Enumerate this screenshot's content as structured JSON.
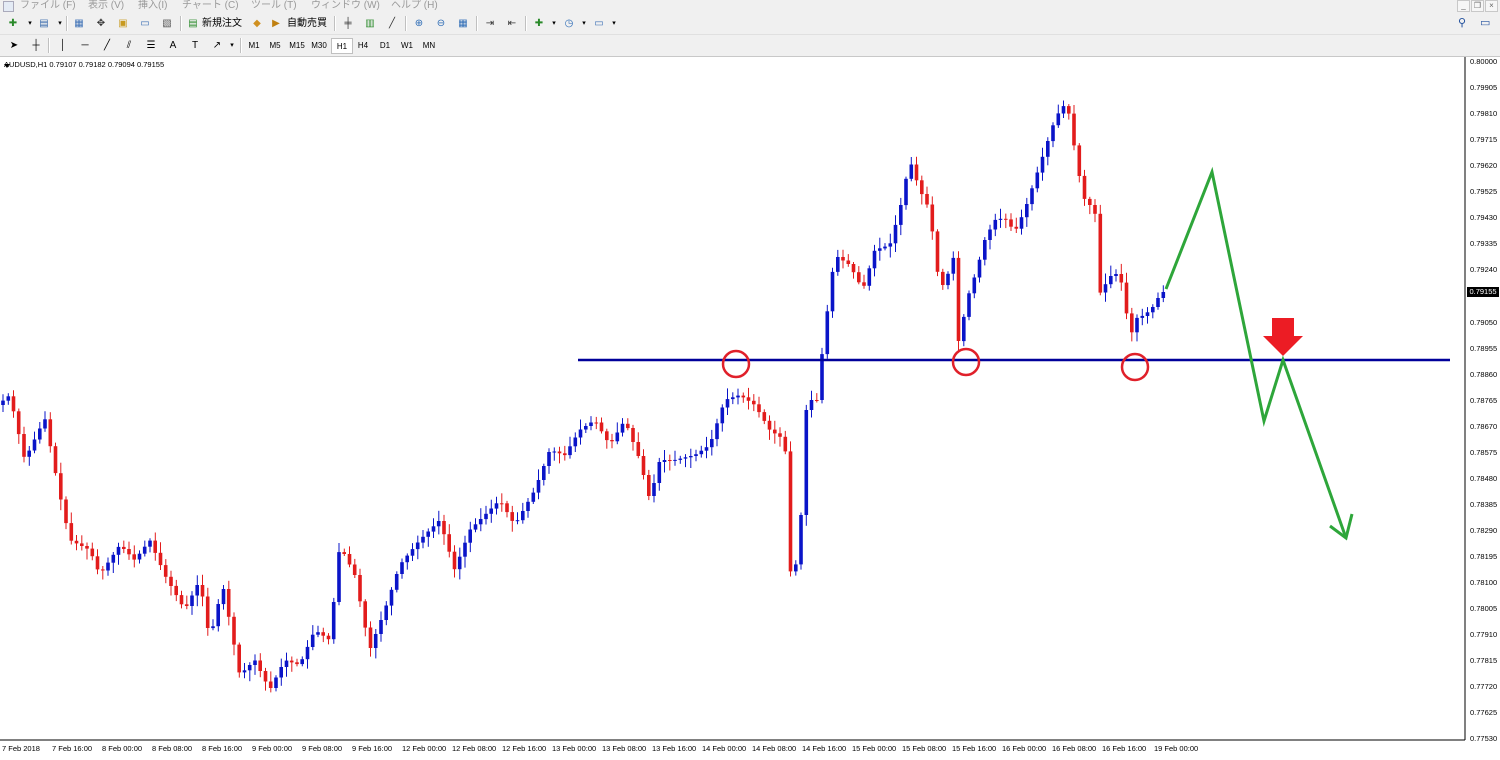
{
  "menu": [
    "ファイル (F)",
    "表示 (V)",
    "挿入(I)",
    "チャート (C)",
    "ツール (T)",
    "ウィンドウ (W)",
    "ヘルプ (H)"
  ],
  "toolbar": {
    "new_order": "新規注文",
    "auto_trade": "自動売買",
    "draw_text": "A",
    "timeframes": [
      "M1",
      "M5",
      "M15",
      "M30",
      "H1",
      "H4",
      "D1",
      "W1",
      "MN"
    ]
  },
  "chart": {
    "symbol_info": "AUDUSD,H1  0.79107 0.79182 0.79094 0.79155",
    "current_price": "0.79155",
    "price_labels": [
      "0.80000",
      "0.79905",
      "0.79810",
      "0.79715",
      "0.79620",
      "0.79525",
      "0.79430",
      "0.79335",
      "0.79240",
      "0.79050",
      "0.78955",
      "0.78860",
      "0.78765",
      "0.78670",
      "0.78575",
      "0.78480",
      "0.78385",
      "0.78290",
      "0.78195",
      "0.78100",
      "0.78005",
      "0.77910",
      "0.77815",
      "0.77720",
      "0.77625",
      "0.77530"
    ],
    "time_labels": [
      "7 Feb 2018",
      "7 Feb 16:00",
      "8 Feb 00:00",
      "8 Feb 08:00",
      "8 Feb 16:00",
      "9 Feb 00:00",
      "9 Feb 08:00",
      "9 Feb 16:00",
      "12 Feb 00:00",
      "12 Feb 08:00",
      "12 Feb 16:00",
      "13 Feb 00:00",
      "13 Feb 08:00",
      "13 Feb 16:00",
      "14 Feb 00:00",
      "14 Feb 08:00",
      "14 Feb 16:00",
      "15 Feb 00:00",
      "15 Feb 08:00",
      "15 Feb 16:00",
      "16 Feb 00:00",
      "16 Feb 08:00",
      "16 Feb 16:00",
      "19 Feb 00:00"
    ],
    "support_level": 0.78914,
    "colors": {
      "bull": "#0a14c8",
      "bear": "#e21c1c",
      "line": "#00009a",
      "annotation": "#e0202a",
      "forecast": "#2ea63a"
    }
  }
}
